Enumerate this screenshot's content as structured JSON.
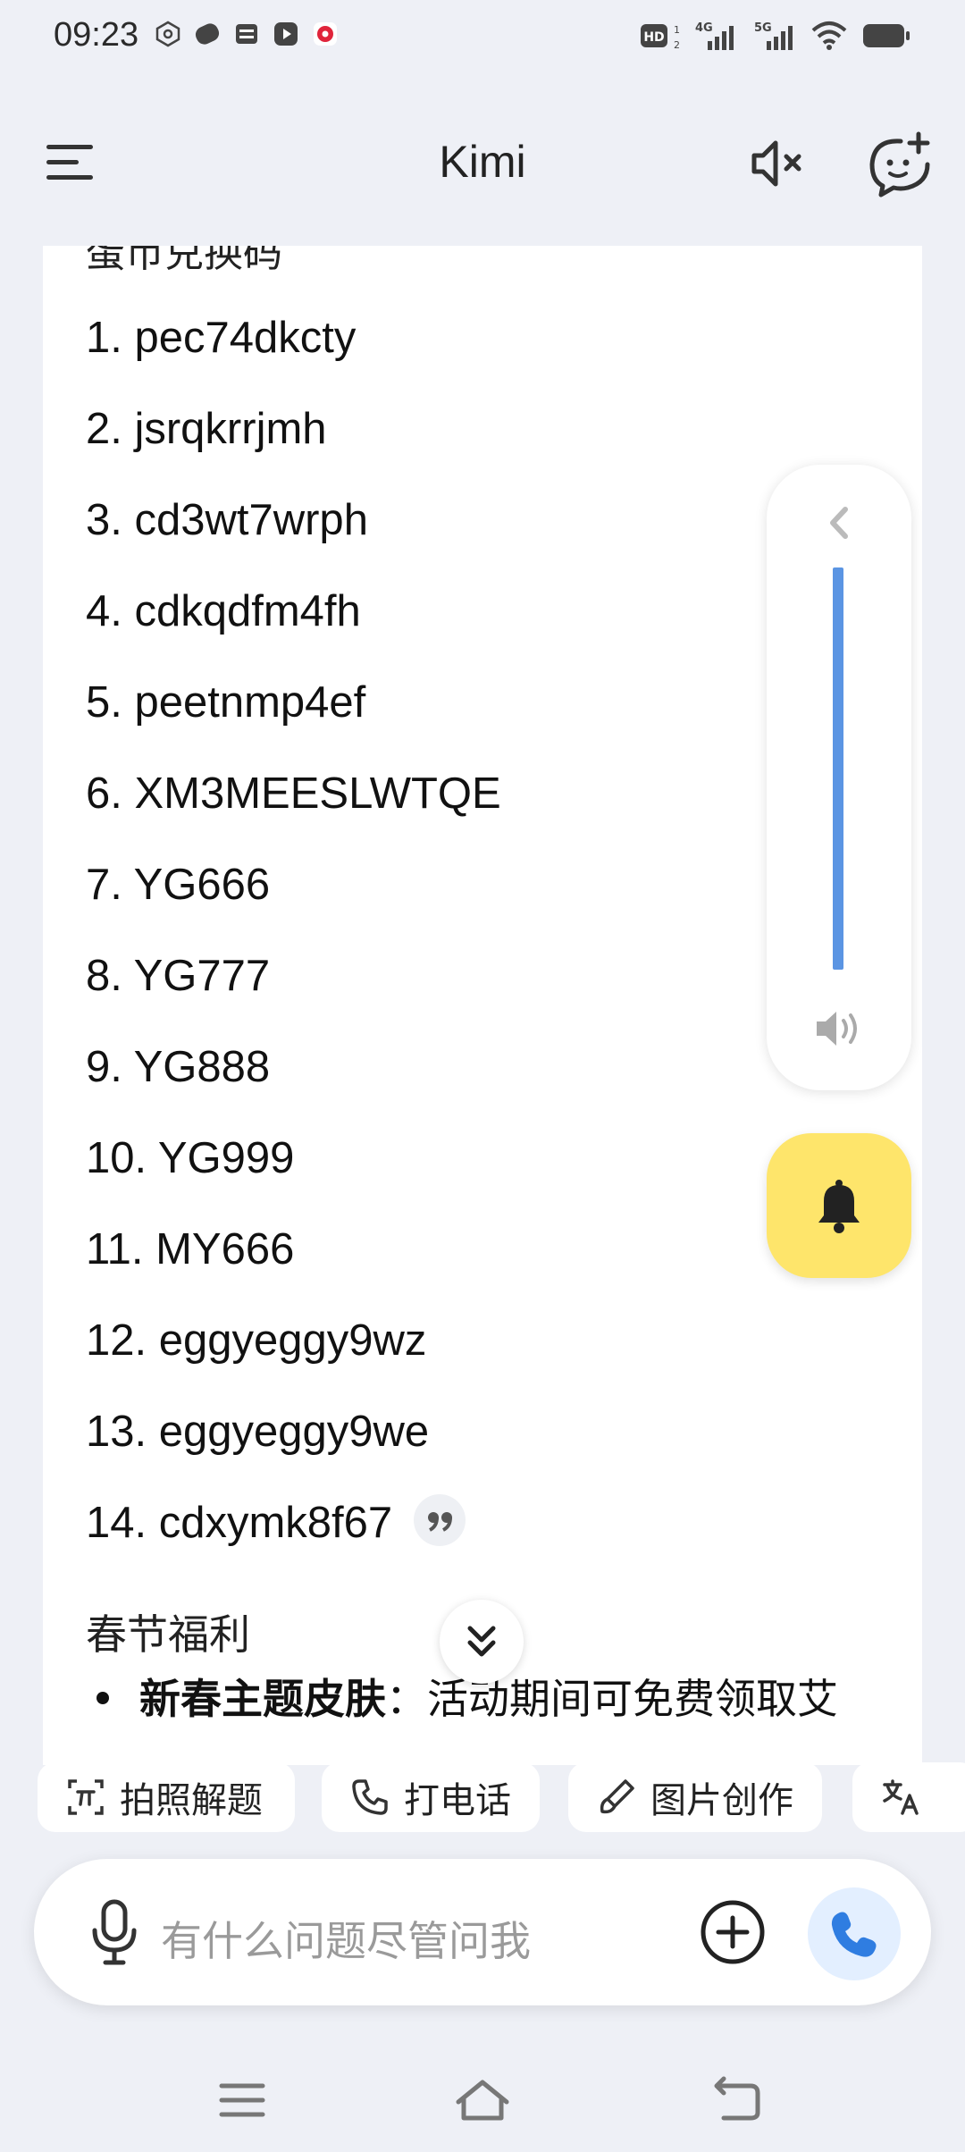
{
  "status_bar": {
    "time": "09:23",
    "left_icons": [
      "settings-hex-icon",
      "link-app-icon",
      "wallet-icon",
      "play-icon",
      "red-app-icon"
    ],
    "right_icons": [
      "hd2-icon",
      "4g-signal-icon",
      "5g-signal-icon",
      "wifi-icon",
      "battery-icon"
    ],
    "hd_label": "HD",
    "net_4g": "4G",
    "net_5g": "5G"
  },
  "header": {
    "title": "Kimi",
    "menu_icon": "hamburger-menu-icon",
    "mute_icon": "speaker-mute-icon",
    "new_chat_icon": "new-chat-icon"
  },
  "content": {
    "partial_heading": "蛋币兑换码",
    "codes": [
      "1. pec74dkcty",
      "2. jsrqkrrjmh",
      "3. cd3wt7wrph",
      "4. cdkqdfm4fh",
      "5. peetnmp4ef",
      "6. XM3MEESLWTQE",
      "7. YG666",
      "8. YG777",
      "9. YG888",
      "10. YG999",
      "11. MY666",
      "12. eggyeggy9wz",
      "13. eggyeggy9we",
      "14. cdxymk8f67"
    ],
    "section_title": "春节福利",
    "bullet_bold": "新春主题皮肤",
    "bullet_text": "：活动期间可免费领取艾"
  },
  "volume_panel": {
    "collapse_icon": "chevron-left-icon",
    "speaker_icon": "speaker-icon"
  },
  "bell_button": {
    "icon": "bell-icon",
    "color": "#fee56b"
  },
  "chips": [
    {
      "label": "拍照解题",
      "icon": "scan-formula-icon"
    },
    {
      "label": "打电话",
      "icon": "phone-icon"
    },
    {
      "label": "图片创作",
      "icon": "brush-icon"
    },
    {
      "label": "",
      "icon": "translate-icon"
    }
  ],
  "input_bar": {
    "placeholder": "有什么问题尽管问我",
    "mic_icon": "microphone-icon",
    "plus_icon": "plus-circle-icon",
    "call_icon": "phone-call-icon",
    "accent": "#2f7de1"
  },
  "nav_bar": {
    "recent_icon": "recent-apps-icon",
    "home_icon": "home-icon",
    "back_icon": "back-icon"
  }
}
